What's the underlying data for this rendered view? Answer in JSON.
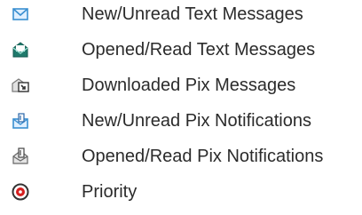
{
  "legend": {
    "items": [
      {
        "icon": "new-unread-text-message-icon",
        "label": "New/Unread Text Messages"
      },
      {
        "icon": "opened-read-text-message-icon",
        "label": "Opened/Read Text Messages"
      },
      {
        "icon": "downloaded-pix-message-icon",
        "label": "Downloaded Pix Messages"
      },
      {
        "icon": "new-unread-pix-notification-icon",
        "label": "New/Unread Pix Notifications"
      },
      {
        "icon": "opened-read-pix-notification-icon",
        "label": "Opened/Read Pix Notifications"
      },
      {
        "icon": "priority-icon",
        "label": "Priority"
      }
    ]
  },
  "colors": {
    "text": "#2b2b2b",
    "envelope_blue": "#3a8fd0",
    "envelope_teal": "#2f8f7f",
    "envelope_gray": "#8a8a8a",
    "priority_red": "#d62020"
  }
}
